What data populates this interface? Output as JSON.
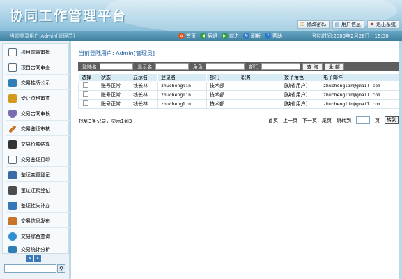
{
  "header": {
    "title": "协同工作管理平台",
    "buttons": [
      {
        "label": "修改密码",
        "icon": "key-icon",
        "color": "#d29a1c"
      },
      {
        "label": "用户信息",
        "icon": "user-info-icon",
        "color": "#3a7fc4"
      },
      {
        "label": "退出系统",
        "icon": "exit-icon",
        "color": "#c62a2a"
      }
    ]
  },
  "navbar": {
    "user": "当前登录用户:Admin[管理员]",
    "links": [
      {
        "label": "首页",
        "icon": "home-icon",
        "color": "#d9531e"
      },
      {
        "label": "后退",
        "icon": "back-icon",
        "color": "#2d9a3a"
      },
      {
        "label": "前进",
        "icon": "forward-icon",
        "color": "#2d9a3a"
      },
      {
        "label": "刷新",
        "icon": "refresh-icon",
        "color": "#2a78c8"
      },
      {
        "label": "帮助",
        "icon": "help-icon",
        "color": "#2a78c8"
      }
    ],
    "time": "登陆时间:2009年2月26日　15:30"
  },
  "sidebar": {
    "items": [
      {
        "label": "项目前置审批",
        "icon": "document-icon",
        "color": "#5b6f80"
      },
      {
        "label": "项目合同审查",
        "icon": "contract-icon",
        "color": "#5b6f80"
      },
      {
        "label": "交易挂牌公示",
        "icon": "monitor-icon",
        "color": "#2f7fb6"
      },
      {
        "label": "受让资格审查",
        "icon": "edit-icon",
        "color": "#d49a1d"
      },
      {
        "label": "交易合同审核",
        "icon": "shield-icon",
        "color": "#7a6bb0"
      },
      {
        "label": "交易鉴证审核",
        "icon": "pencil-icon",
        "color": "#c8742a"
      },
      {
        "label": "交易价款结算",
        "icon": "calculator-icon",
        "color": "#333333"
      },
      {
        "label": "交易鉴证打印",
        "icon": "print-icon",
        "color": "#5b6f80"
      },
      {
        "label": "鉴证变更登记",
        "icon": "book-icon",
        "color": "#3c6aa8"
      },
      {
        "label": "鉴证注销登记",
        "icon": "stamp-icon",
        "color": "#4c4c4c"
      },
      {
        "label": "鉴证挂失补办",
        "icon": "document-refresh-icon",
        "color": "#3479b8"
      },
      {
        "label": "交易信息发布",
        "icon": "publish-icon",
        "color": "#c8742a"
      },
      {
        "label": "交易综合查询",
        "icon": "magnifier-icon",
        "color": "#2f8fd0"
      },
      {
        "label": "交易统计分析",
        "icon": "chart-icon",
        "color": "#2f7fb6"
      }
    ],
    "scroll_down": "∨",
    "scroll_up": "∧",
    "search_placeholder": ""
  },
  "main": {
    "current_user": "当前登陆用户: Admin[管理员]",
    "filters": {
      "login_label": "登陆名:",
      "display_label": "显示名:",
      "role_label": "角色:",
      "dept_label": "部门:",
      "query_button": "查 询",
      "all_button": "全 部"
    },
    "columns": [
      "选择",
      "状态",
      "显示名",
      "登录名",
      "部门",
      "职务",
      "授予角色",
      "电子邮件"
    ],
    "rows": [
      {
        "status": "账号正常",
        "display": "钱长林",
        "login": "zhuchenglin",
        "dept": "技术部",
        "position": "",
        "role": "[缺省用户]",
        "email": "zhuchenglin@gmail.com"
      },
      {
        "status": "账号正常",
        "display": "钱长林",
        "login": "zhuchenglin",
        "dept": "技术部",
        "position": "",
        "role": "[缺省用户]",
        "email": "zhuchenglin@gmail.com"
      },
      {
        "status": "账号正常",
        "display": "钱长林",
        "login": "zhuchenglin",
        "dept": "技术部",
        "position": "",
        "role": "[缺省用户]",
        "email": "zhuchenglin@gmail.com"
      }
    ],
    "pager": {
      "info": "找到3条记录，显示1到3",
      "first": "首页",
      "prev": "上一页",
      "next": "下一页",
      "last": "尾页",
      "jump": "跳转到",
      "page_unit": "页",
      "go": "转到"
    }
  }
}
